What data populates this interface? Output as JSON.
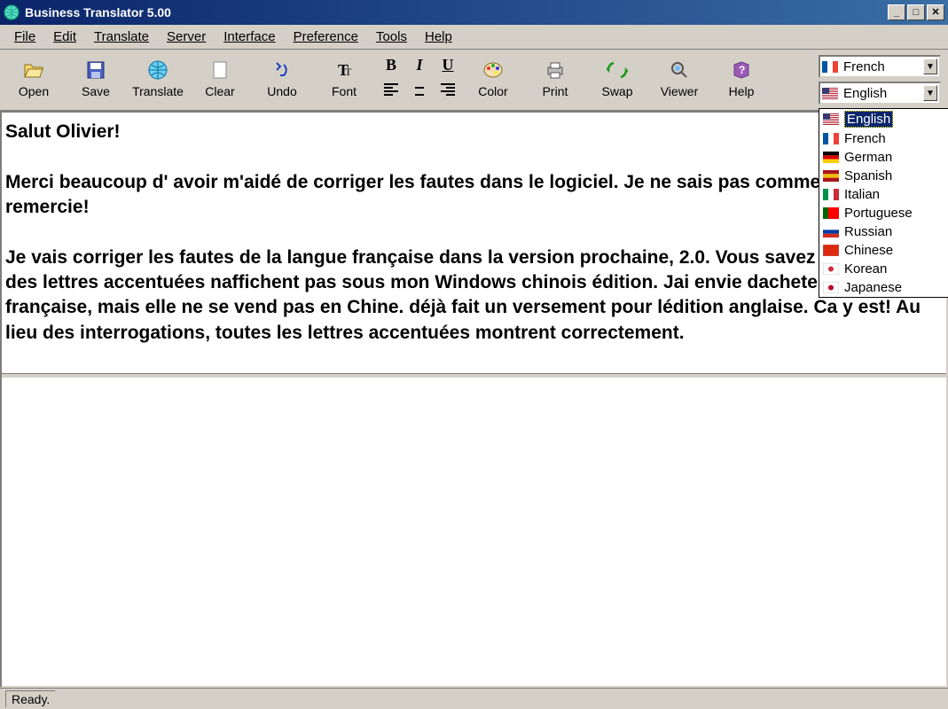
{
  "title": "Business Translator 5.00",
  "menu": [
    "File",
    "Edit",
    "Translate",
    "Server",
    "Interface",
    "Preference",
    "Tools",
    "Help"
  ],
  "toolbar": {
    "open": "Open",
    "save": "Save",
    "translate": "Translate",
    "clear": "Clear",
    "undo": "Undo",
    "font": "Font",
    "color": "Color",
    "print": "Print",
    "swap": "Swap",
    "viewer": "Viewer",
    "help": "Help"
  },
  "format": {
    "bold": "B",
    "italic": "I",
    "underline": "U"
  },
  "lang": {
    "source": "French",
    "target": "English",
    "options": [
      "English",
      "French",
      "German",
      "Spanish",
      "Italian",
      "Portuguese",
      "Russian",
      "Chinese",
      "Korean",
      "Japanese"
    ]
  },
  "text": {
    "p1": "Salut Olivier!",
    "p2": "Merci beaucoup d' avoir m'aidé de corriger les fautes dans le logiciel. Je ne sais pas comment je vous remercie!",
    "p3": "Je vais corriger les fautes de la langue française dans la version prochaine, 2.0. Vous savez ce problème, des lettres accentuées naffichent pas sous mon Windows chinois édition. Jai envie dacheter lédition française, mais elle ne se vend pas en Chine. déjà fait un versement pour lédition anglaise. Ca y est! Au lieu des interrogations, toutes les lettres accentuées montrent correctement."
  },
  "status": "Ready.",
  "flags": {
    "English": {
      "stripes": true,
      "colors": [
        "#b22234",
        "#ffffff",
        "#3c3b6e"
      ]
    },
    "French": {
      "v": [
        "#0055a4",
        "#ffffff",
        "#ef4135"
      ]
    },
    "German": {
      "h": [
        "#000000",
        "#dd0000",
        "#ffce00"
      ]
    },
    "Spanish": {
      "h": [
        "#aa151b",
        "#f1bf00",
        "#aa151b"
      ]
    },
    "Italian": {
      "v": [
        "#009246",
        "#ffffff",
        "#ce2b37"
      ]
    },
    "Portuguese": {
      "v": [
        "#006600",
        "#ff0000",
        "#ff0000"
      ]
    },
    "Russian": {
      "h": [
        "#ffffff",
        "#0039a6",
        "#d52b1e"
      ]
    },
    "Chinese": {
      "solid": "#de2910"
    },
    "Korean": {
      "solid": "#ffffff",
      "dot": "#cd2e3a"
    },
    "Japanese": {
      "solid": "#ffffff",
      "dot": "#bc002d"
    }
  }
}
